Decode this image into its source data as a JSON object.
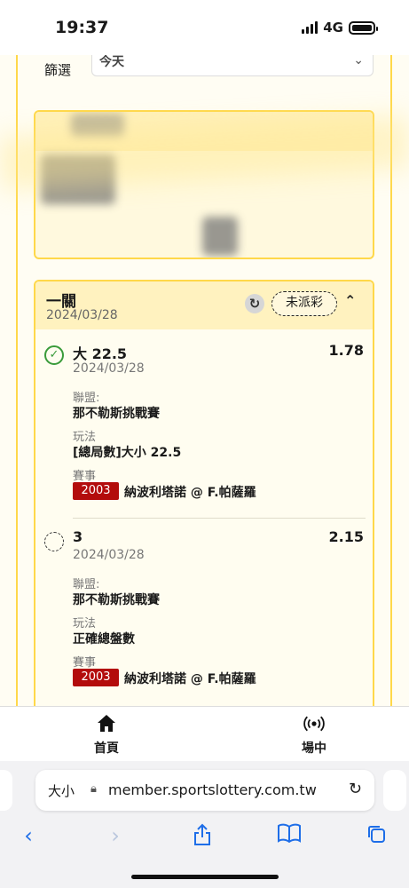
{
  "status_bar": {
    "time": "19:37",
    "network": "4G"
  },
  "filter": {
    "label": "篩選",
    "value": "今天"
  },
  "bet_card": {
    "title": "一關",
    "date": "2024/03/28",
    "status": "未派彩",
    "legs": [
      {
        "selection": "大 22.5",
        "date": "2024/03/28",
        "odds": "1.78",
        "state": "settled-win",
        "league_label": "聯盟:",
        "league": "那不勒斯挑戰賽",
        "market_label": "玩法",
        "market": "[總局數]大小 22.5",
        "event_label": "賽事",
        "event_code": "2003",
        "event": "納波利塔諾 @ F.帕薩羅"
      },
      {
        "selection": "3",
        "date": "2024/03/28",
        "odds": "2.15",
        "state": "pending",
        "league_label": "聯盟:",
        "league": "那不勒斯挑戰賽",
        "market_label": "玩法",
        "market": "正確總盤數",
        "event_label": "賽事",
        "event_code": "2003",
        "event": "納波利塔諾 @ F.帕薩羅"
      }
    ]
  },
  "bottom_nav": [
    {
      "label": "首頁",
      "icon": "home-icon"
    },
    {
      "label": "場中",
      "icon": "live-broadcast-icon"
    }
  ],
  "browser": {
    "text_size": "大小",
    "url": "member.sportslottery.com.tw"
  },
  "colors": {
    "accent": "#ffd84a",
    "header": "#fff2bf",
    "event_code_bg": "#b30c0c",
    "ok": "#3a9b3a",
    "link": "#1e6ee8"
  }
}
